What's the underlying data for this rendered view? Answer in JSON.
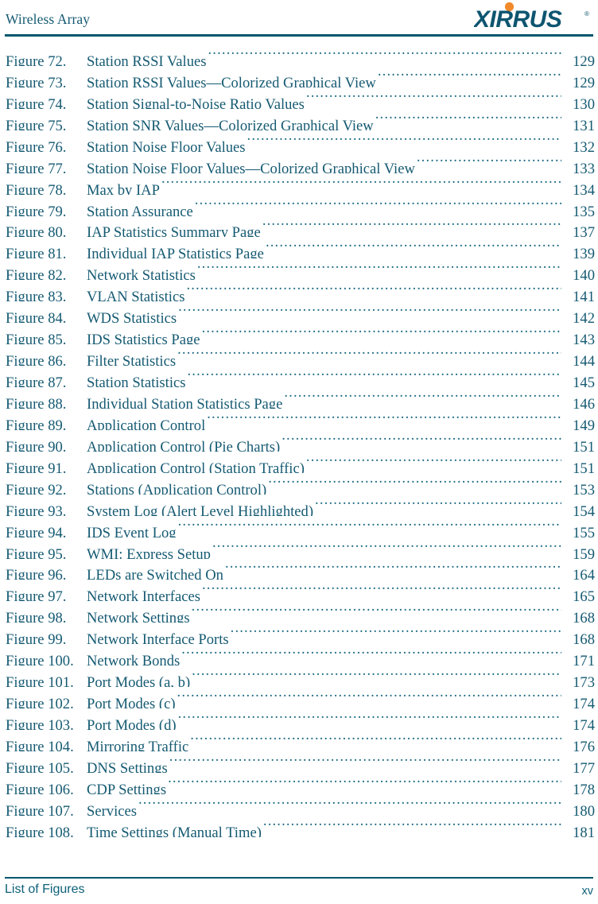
{
  "header": {
    "title": "Wireless Array",
    "logo": {
      "wordmark": "XIRRUS",
      "trademark": "®",
      "dot_color": "#f08a2a",
      "text_color": "#0d5570"
    },
    "rule_color": "#03566e"
  },
  "footer": {
    "section": "List of Figures",
    "page_number": "xv",
    "rule_color": "#03566e"
  },
  "colors": {
    "text": "#155a72",
    "leader": "#1d6b84",
    "accent_orange": "#f08a2a",
    "rule": "#03566e",
    "background": "#ffffff"
  },
  "figure_list": [
    {
      "label": "Figure 72.",
      "title": "Station RSSI Values ",
      "page": "129"
    },
    {
      "label": "Figure 73.",
      "title": "Station RSSI Values—Colorized Graphical View ",
      "page": "129"
    },
    {
      "label": "Figure 74.",
      "title": "Station Signal-to-Noise Ratio Values",
      "page": "130"
    },
    {
      "label": "Figure 75.",
      "title": "Station SNR Values—Colorized Graphical View",
      "page": "131"
    },
    {
      "label": "Figure 76.",
      "title": "Station Noise Floor Values",
      "page": "132"
    },
    {
      "label": "Figure 77.",
      "title": "Station Noise Floor Values—Colorized Graphical View ",
      "page": "133"
    },
    {
      "label": "Figure 78.",
      "title": "Max by IAP",
      "page": "134"
    },
    {
      "label": "Figure 79.",
      "title": "Station Assurance",
      "page": "135"
    },
    {
      "label": "Figure 80.",
      "title": "IAP Statistics Summary Page",
      "page": "137"
    },
    {
      "label": "Figure 81.",
      "title": "Individual IAP Statistics Page ",
      "page": "139"
    },
    {
      "label": "Figure 82.",
      "title": "Network Statistics",
      "page": "140"
    },
    {
      "label": "Figure 83.",
      "title": "VLAN Statistics",
      "page": "141"
    },
    {
      "label": "Figure 84.",
      "title": "WDS Statistics",
      "page": "142"
    },
    {
      "label": "Figure 85.",
      "title": "IDS Statistics Page ",
      "page": "143"
    },
    {
      "label": "Figure 86.",
      "title": "Filter Statistics",
      "page": "144"
    },
    {
      "label": "Figure 87.",
      "title": "Station Statistics",
      "page": "145"
    },
    {
      "label": "Figure 88.",
      "title": "Individual Station Statistics Page",
      "page": "146"
    },
    {
      "label": "Figure 89.",
      "title": "Application Control",
      "page": "149"
    },
    {
      "label": "Figure 90.",
      "title": "Application Control (Pie Charts)",
      "page": "151"
    },
    {
      "label": "Figure 91.",
      "title": "Application Control (Station Traffic)",
      "page": "151"
    },
    {
      "label": "Figure 92.",
      "title": "Stations (Application Control)",
      "page": "153"
    },
    {
      "label": "Figure 93.",
      "title": "System Log (Alert Level Highlighted)",
      "page": "154"
    },
    {
      "label": "Figure 94.",
      "title": "IDS Event Log ",
      "page": "155"
    },
    {
      "label": "Figure 95.",
      "title": "WMI: Express Setup",
      "page": "159"
    },
    {
      "label": "Figure 96.",
      "title": "LEDs are Switched On",
      "page": "164"
    },
    {
      "label": "Figure 97.",
      "title": "Network Interfaces",
      "page": "165"
    },
    {
      "label": "Figure 98.",
      "title": "Network Settings",
      "page": "168"
    },
    {
      "label": "Figure 99.",
      "title": "Network Interface Ports",
      "page": "168"
    },
    {
      "label": "Figure 100.",
      "title": "Network Bonds",
      "page": "171"
    },
    {
      "label": "Figure 101.",
      "title": "Port Modes (a, b)",
      "page": "173"
    },
    {
      "label": "Figure 102.",
      "title": "Port Modes (c)",
      "page": "174"
    },
    {
      "label": "Figure 103.",
      "title": "Port Modes (d)",
      "page": "174"
    },
    {
      "label": "Figure 104.",
      "title": "Mirroring Traffic",
      "page": "176"
    },
    {
      "label": "Figure 105.",
      "title": "DNS Settings",
      "page": "177"
    },
    {
      "label": "Figure 106.",
      "title": "CDP Settings",
      "page": "178"
    },
    {
      "label": "Figure 107.",
      "title": "Services",
      "page": "180"
    },
    {
      "label": "Figure 108.",
      "title": "Time Settings (Manual Time)",
      "page": "181"
    }
  ]
}
